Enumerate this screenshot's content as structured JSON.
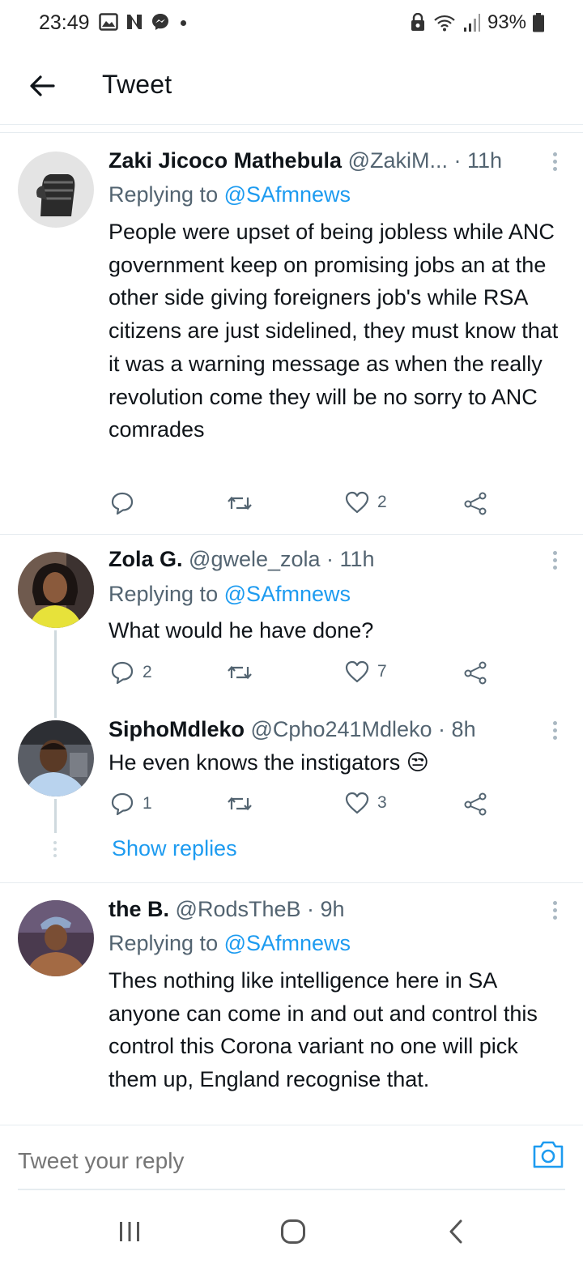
{
  "status_bar": {
    "time": "23:49",
    "battery": "93%"
  },
  "header": {
    "title": "Tweet"
  },
  "tweets": [
    {
      "name": "Zaki Jicoco Mathebula",
      "handle_time": "@ZakiM... · 11h",
      "replying_prefix": "Replying to",
      "replying_to": "@SAfmnews",
      "text": "People were upset of being jobless while ANC government keep on promising jobs an at the other side giving foreigners job's while RSA citizens are just sidelined, they must know that it was a warning message as when the really revolution come they will be no sorry to ANC comrades",
      "replies": "",
      "retweets": "",
      "likes": "2"
    },
    {
      "name": "Zola G.",
      "handle_time": "@gwele_zola · 11h",
      "replying_prefix": "Replying to",
      "replying_to": "@SAfmnews",
      "text": "What would he have done?",
      "replies": "2",
      "retweets": "",
      "likes": "7"
    },
    {
      "name": "SiphoMdleko",
      "handle_time": "@Cpho241Mdleko · 8h",
      "text": "He even knows the instigators",
      "emoji": "😒",
      "replies": "1",
      "retweets": "",
      "likes": "3"
    },
    {
      "name": "the B.",
      "handle_time": "@RodsTheB · 9h",
      "replying_prefix": "Replying to",
      "replying_to": "@SAfmnews",
      "text": "Thes nothing like intelligence here in SA anyone can come in and out and control this control this Corona variant no one will pick them up, England recognise that."
    }
  ],
  "show_replies": "Show replies",
  "reply": {
    "placeholder": "Tweet your reply"
  },
  "colors": {
    "accent": "#1d9bf0",
    "secondary_text": "#536471",
    "divider": "#e6ecf0"
  },
  "icons": [
    "back-arrow-icon",
    "reply-icon",
    "retweet-icon",
    "like-icon",
    "share-icon",
    "more-icon",
    "camera-icon",
    "recent-apps-icon",
    "home-icon",
    "nav-back-icon"
  ]
}
